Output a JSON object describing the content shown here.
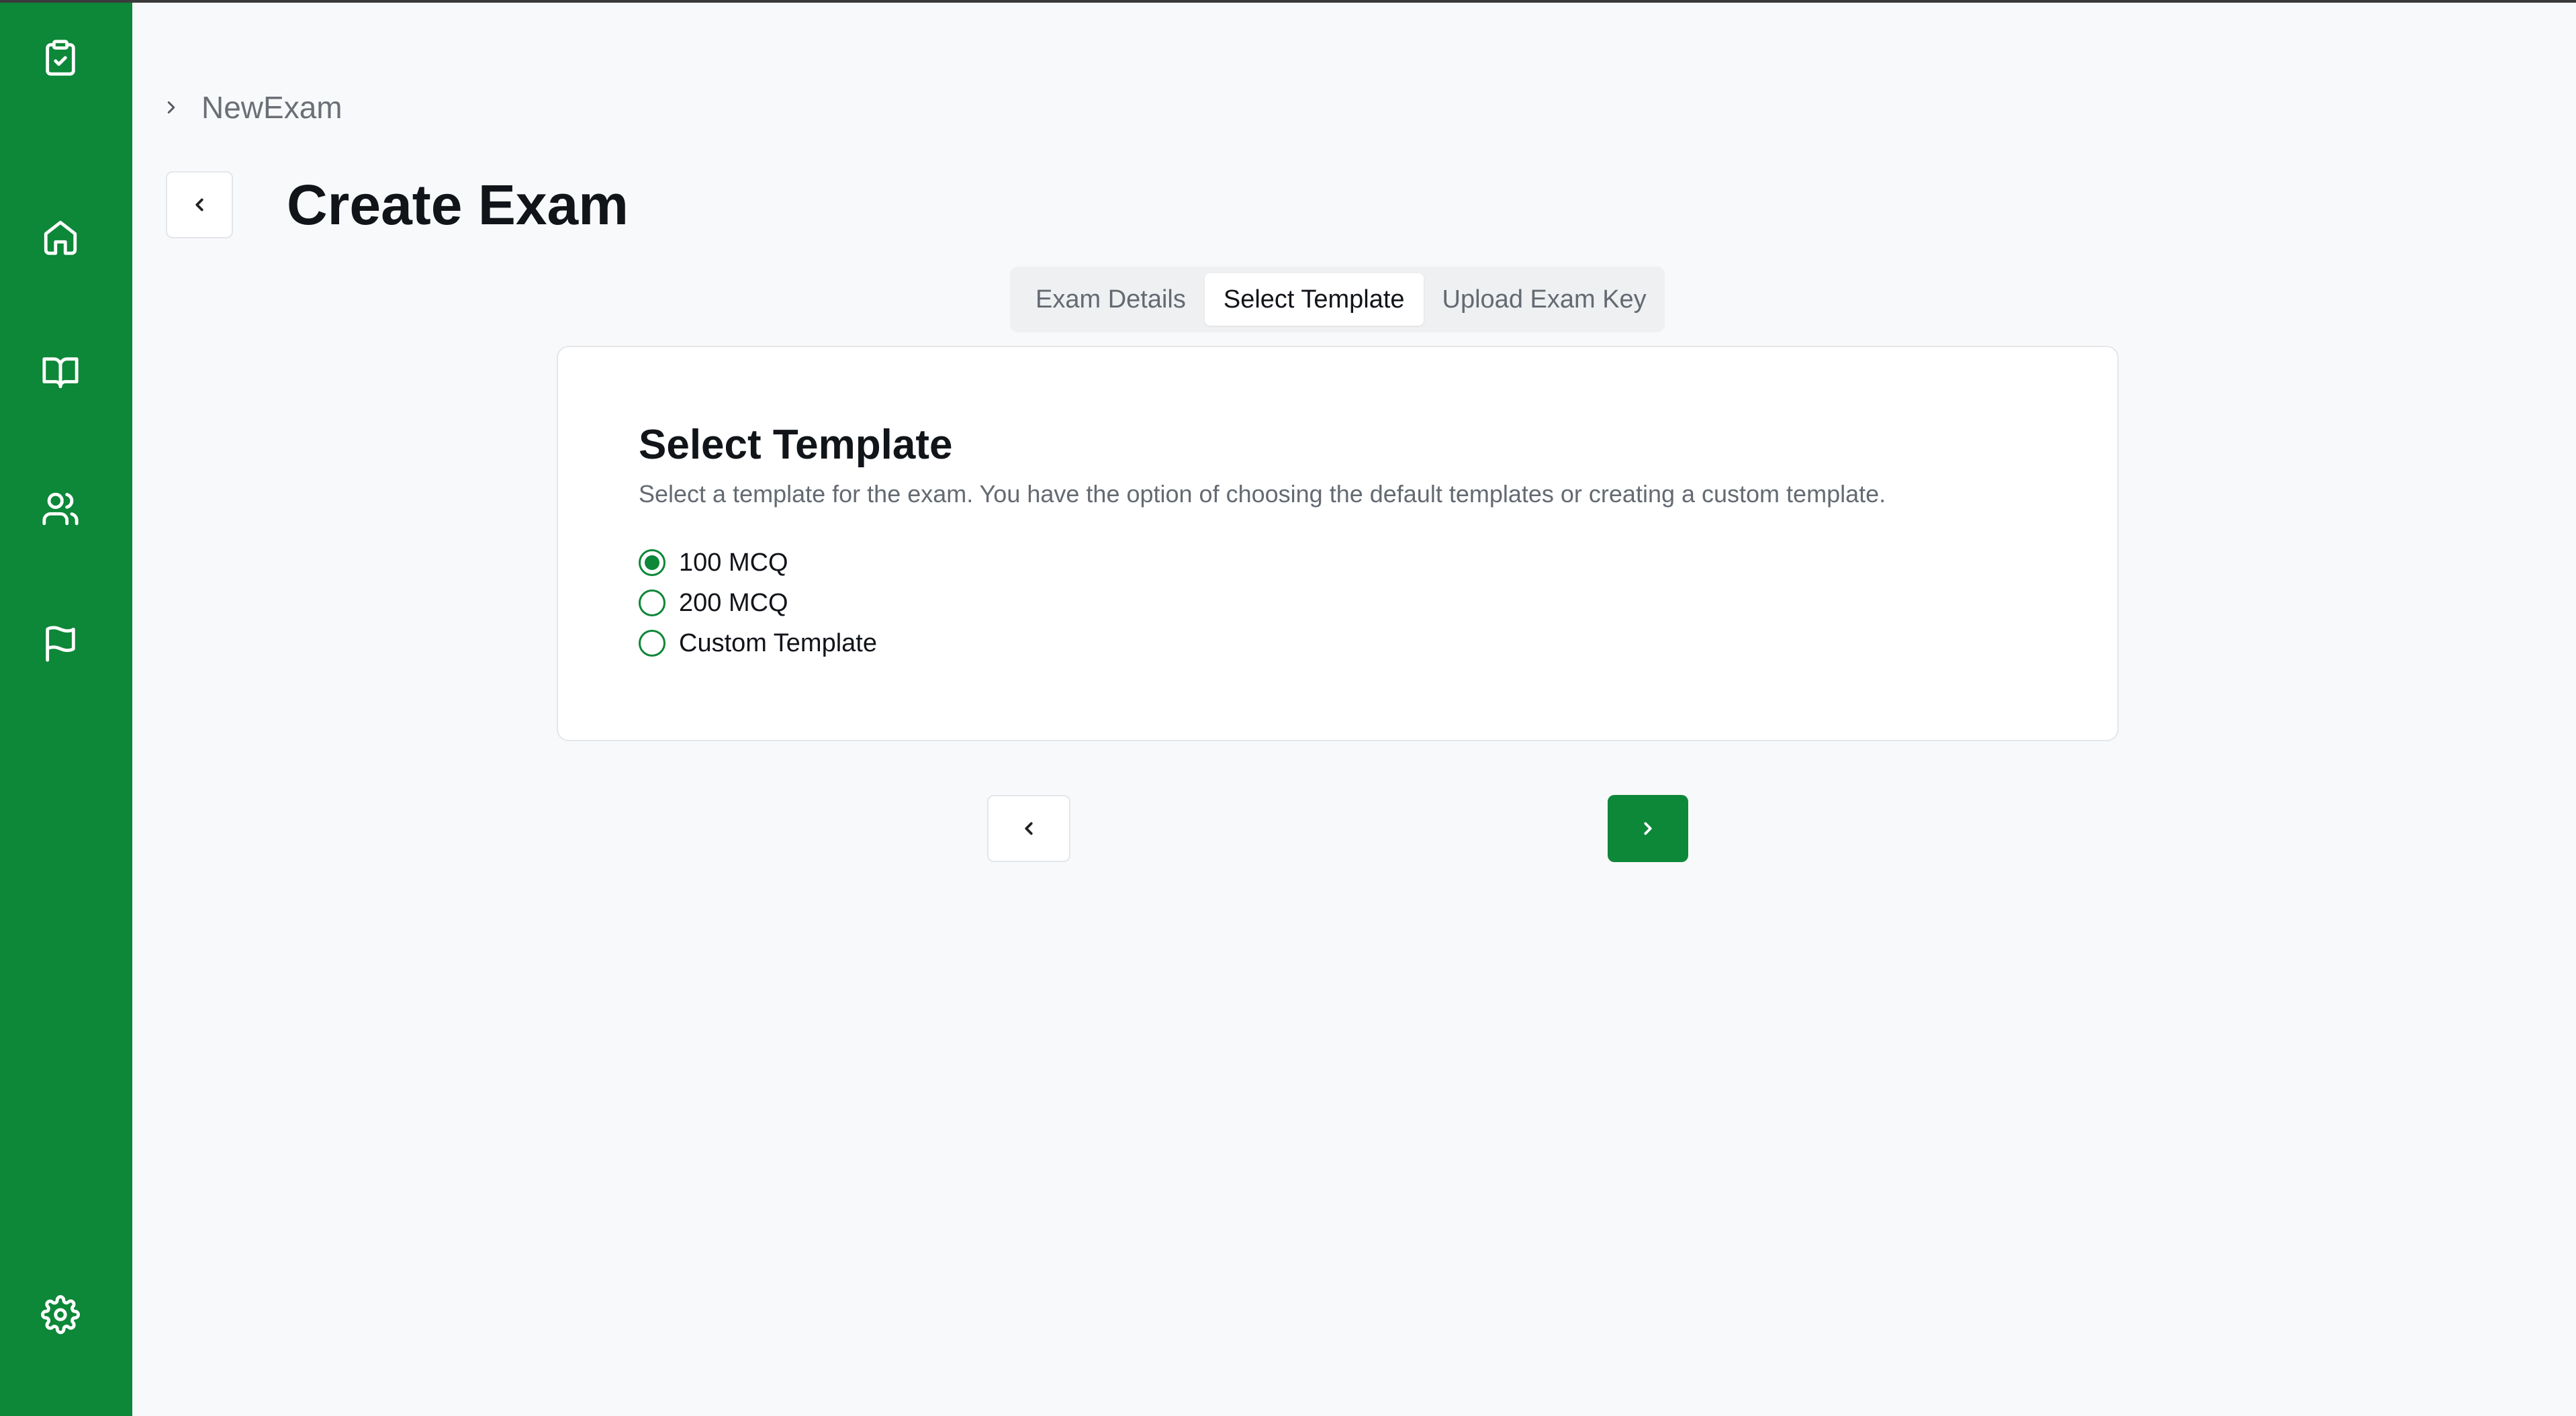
{
  "sidebar": {
    "logo_icon": "clipboard-check-icon",
    "items": [
      {
        "icon": "home-icon"
      },
      {
        "icon": "book-open-icon"
      },
      {
        "icon": "users-icon"
      },
      {
        "icon": "flag-icon"
      }
    ],
    "settings_icon": "gear-icon",
    "color": "#0d8738"
  },
  "breadcrumb": {
    "current": "NewExam"
  },
  "header": {
    "title": "Create Exam"
  },
  "tabs": [
    {
      "label": "Exam Details",
      "active": false
    },
    {
      "label": "Select Template",
      "active": true
    },
    {
      "label": "Upload Exam Key",
      "active": false
    }
  ],
  "card": {
    "title": "Select Template",
    "description": "Select a template for the exam. You have the option of choosing the default templates or creating a custom template.",
    "options": [
      {
        "label": "100 MCQ",
        "selected": true
      },
      {
        "label": "200 MCQ",
        "selected": false
      },
      {
        "label": "Custom Template",
        "selected": false
      }
    ]
  },
  "colors": {
    "accent": "#0d8738",
    "background": "#f8f9fa"
  }
}
